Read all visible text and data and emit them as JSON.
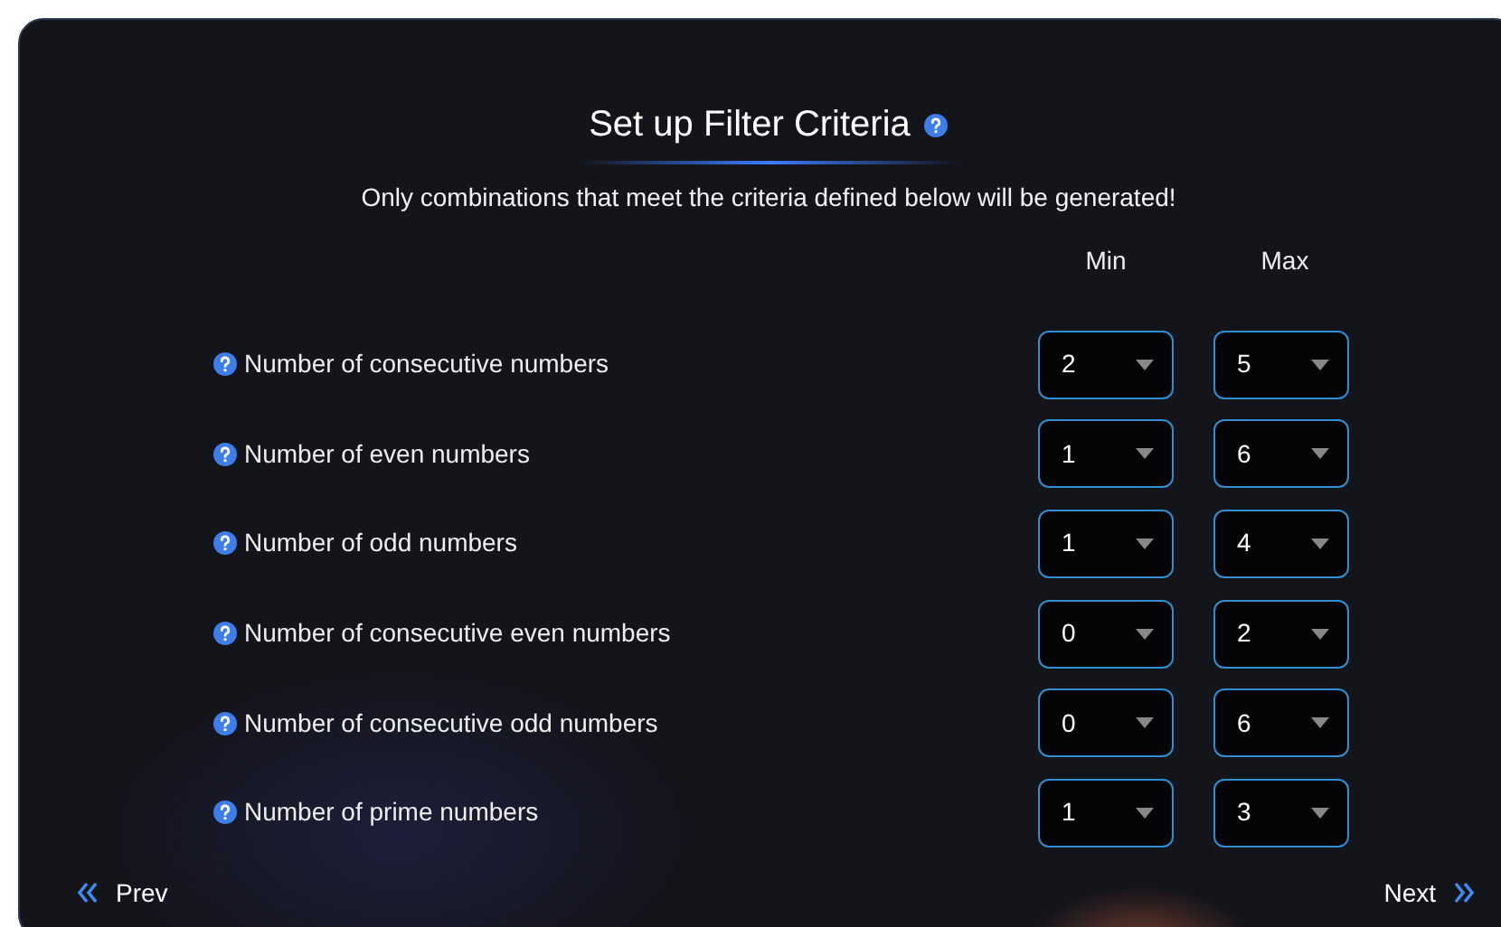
{
  "title": "Set up Filter Criteria",
  "subtitle": "Only combinations that meet the criteria defined below will be generated!",
  "columns": [
    "Min",
    "Max"
  ],
  "criteria": [
    {
      "label": "Number of consecutive numbers",
      "min": "2",
      "max": "5"
    },
    {
      "label": "Number of even numbers",
      "min": "1",
      "max": "6"
    },
    {
      "label": "Number of odd numbers",
      "min": "1",
      "max": "4"
    },
    {
      "label": "Number of consecutive even numbers",
      "min": "0",
      "max": "2"
    },
    {
      "label": "Number of consecutive odd numbers",
      "min": "0",
      "max": "6"
    },
    {
      "label": "Number of prime numbers",
      "min": "1",
      "max": "3"
    }
  ],
  "prev": "Prev",
  "next": "Next"
}
